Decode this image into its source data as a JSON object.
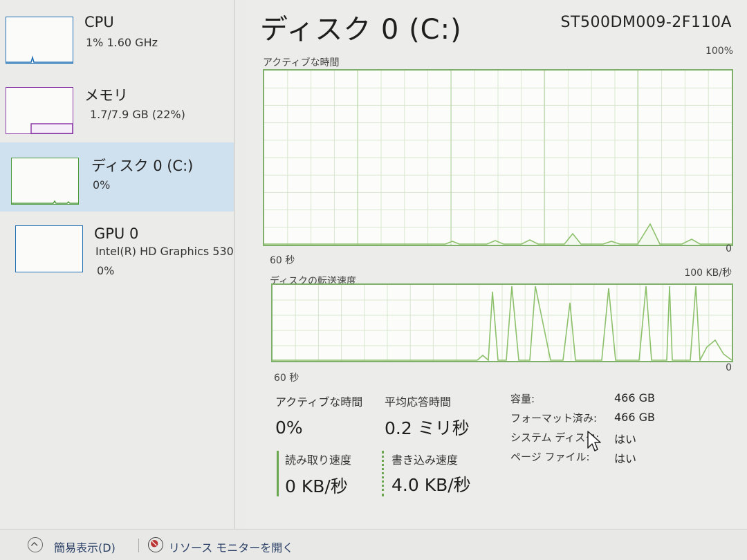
{
  "sidebar": {
    "items": [
      {
        "title": "CPU",
        "subtitle": "1%  1.60 GHz",
        "color": "#1f6fb5"
      },
      {
        "title": "メモリ",
        "subtitle": "1.7/7.9 GB (22%)",
        "color": "#8b3aa8"
      },
      {
        "title": "ディスク 0 (C:)",
        "subtitle": "0%",
        "color": "#4c9a3a",
        "selected": true
      },
      {
        "title": "GPU 0",
        "subtitle": "Intel(R) HD Graphics 530",
        "subtitle2": "0%",
        "color": "#1f6fb5"
      }
    ]
  },
  "header": {
    "title": "ディスク 0 (C:)",
    "model": "ST500DM009-2F110A"
  },
  "active_graph": {
    "label": "アクティブな時間",
    "max_label": "100%",
    "min_label": "0",
    "time_label": "60 秒"
  },
  "transfer_graph": {
    "label": "ディスクの転送速度",
    "max_label": "100 KB/秒",
    "min_label": "0",
    "time_label": "60 秒"
  },
  "stats": {
    "active_time": {
      "label": "アクティブな時間",
      "value": "0%"
    },
    "avg_response": {
      "label": "平均応答時間",
      "value": "0.2 ミリ秒"
    },
    "read_speed": {
      "label": "読み取り速度",
      "value": "0 KB/秒"
    },
    "write_speed": {
      "label": "書き込み速度",
      "value": "4.0 KB/秒"
    }
  },
  "info": [
    {
      "key": "容量:",
      "value": "466 GB"
    },
    {
      "key": "フォーマット済み:",
      "value": "466 GB"
    },
    {
      "key": "システム ディスク:",
      "value": "はい"
    },
    {
      "key": "ページ ファイル:",
      "value": "はい"
    }
  ],
  "footer": {
    "fewer_details": "簡易表示(D)",
    "resource_monitor": "リソース モニターを開く"
  },
  "colors": {
    "disk_green": "#7fb06a",
    "disk_line": "#8cc06a",
    "grid": "#d8e6cf",
    "selected_bg": "#cfe0ef"
  },
  "icons": [
    "chevron-up-icon",
    "resource-monitor-icon",
    "mouse-cursor-icon"
  ]
}
